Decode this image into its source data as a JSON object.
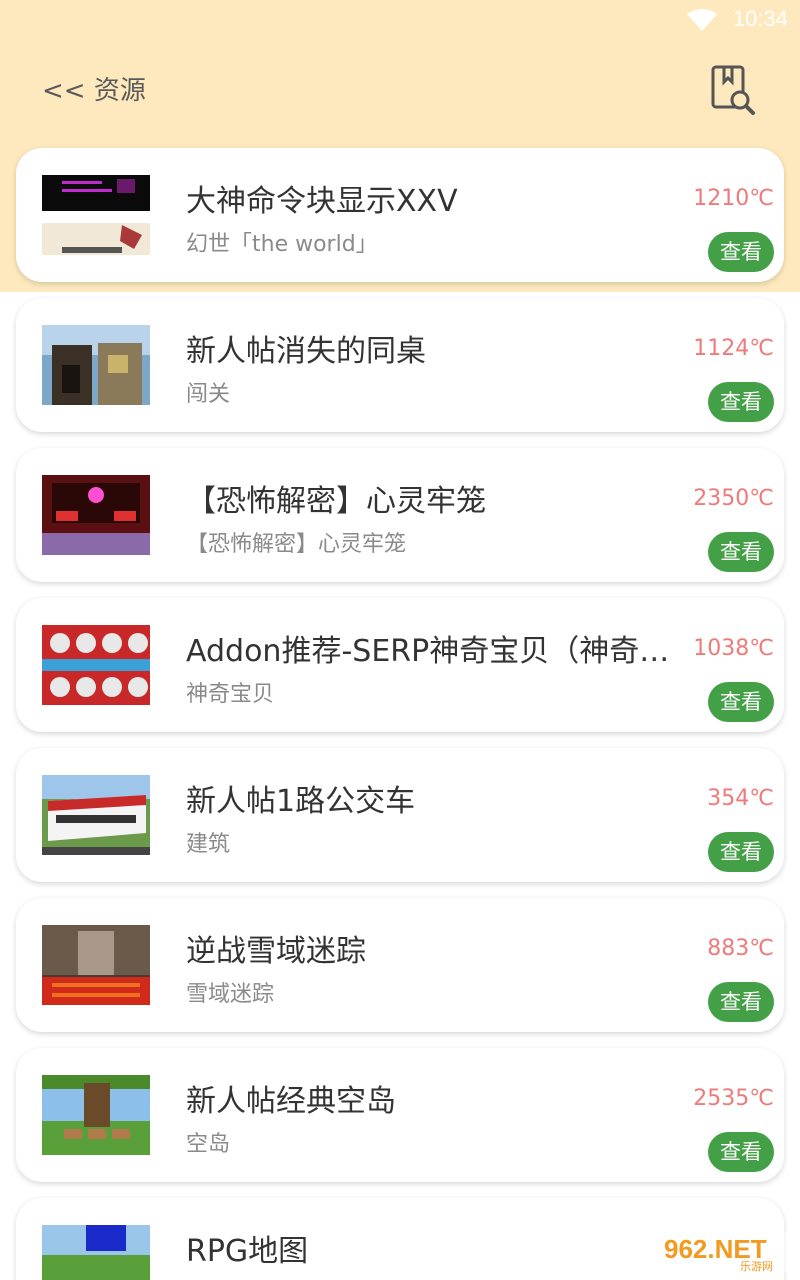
{
  "status": {
    "time": "10:34"
  },
  "header": {
    "back_label": "<< 资源"
  },
  "items": [
    {
      "title": "大神命令块显示XXV",
      "subtitle": "幻世「the world」",
      "temp": "1210℃",
      "button": "查看"
    },
    {
      "title": "新人帖消失的同桌",
      "subtitle": "闯关",
      "temp": "1124℃",
      "button": "查看"
    },
    {
      "title": "【恐怖解密】心灵牢笼",
      "subtitle": "【恐怖解密】心灵牢笼",
      "temp": "2350℃",
      "button": "查看"
    },
    {
      "title": "Addon推荐-SERP神奇宝贝（神奇宝…",
      "subtitle": "神奇宝贝",
      "temp": "1038℃",
      "button": "查看"
    },
    {
      "title": "新人帖1路公交车",
      "subtitle": "建筑",
      "temp": "354℃",
      "button": "查看"
    },
    {
      "title": "逆战雪域迷踪",
      "subtitle": "雪域迷踪",
      "temp": "883℃",
      "button": "查看"
    },
    {
      "title": "新人帖经典空岛",
      "subtitle": "空岛",
      "temp": "2535℃",
      "button": "查看"
    },
    {
      "title": "RPG地图",
      "subtitle": "",
      "temp": "",
      "button": ""
    }
  ],
  "watermark": {
    "main": "962.NET",
    "sub": "乐游网"
  },
  "colors": {
    "header_bg": "#fde9bd",
    "button_green": "#43a047",
    "temp_red": "#f07a7a"
  }
}
